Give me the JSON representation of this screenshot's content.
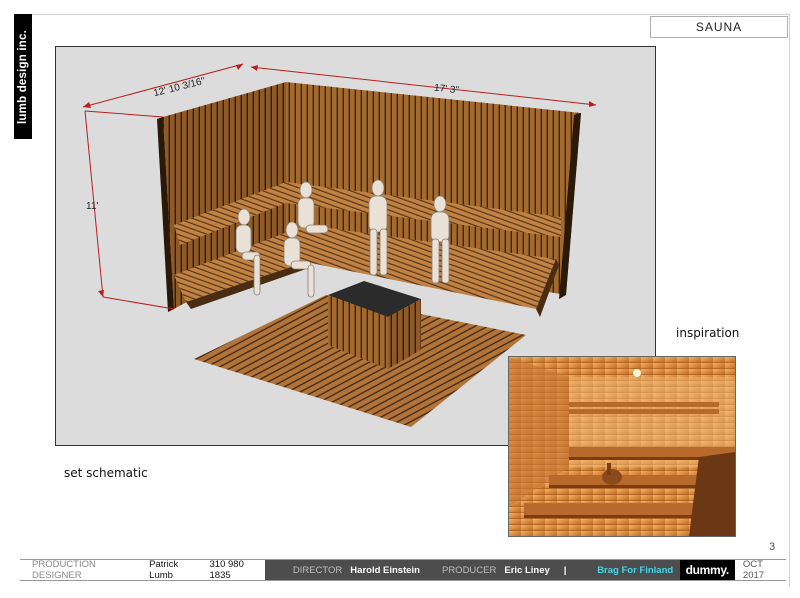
{
  "company": {
    "logo_text": "lumb design inc."
  },
  "slide_title": "SAUNA",
  "schematic": {
    "caption": "set schematic",
    "dimensions": {
      "width": "12' 10 3/16\"",
      "length": "17' 3\"",
      "height": "11'"
    }
  },
  "inspiration": {
    "caption": "inspiration"
  },
  "page_number": "3",
  "footer": {
    "production_designer_label": "PRODUCTION DESIGNER",
    "production_designer_name": "Patrick Lumb",
    "phone": "310 980 1835",
    "director_label": "DIRECTOR",
    "director_name": "Harold Einstein",
    "producer_label": "PRODUCER",
    "producer_name": "Eric Liney",
    "separator": "|",
    "project": "Brag For Finland",
    "brand": "dummy.",
    "date": "OCT 2017"
  },
  "colors": {
    "wood": "#a86a32",
    "dimension": "#b81e1e",
    "panel_bg": "#dcdcdc",
    "accent": "#43d6ea"
  }
}
